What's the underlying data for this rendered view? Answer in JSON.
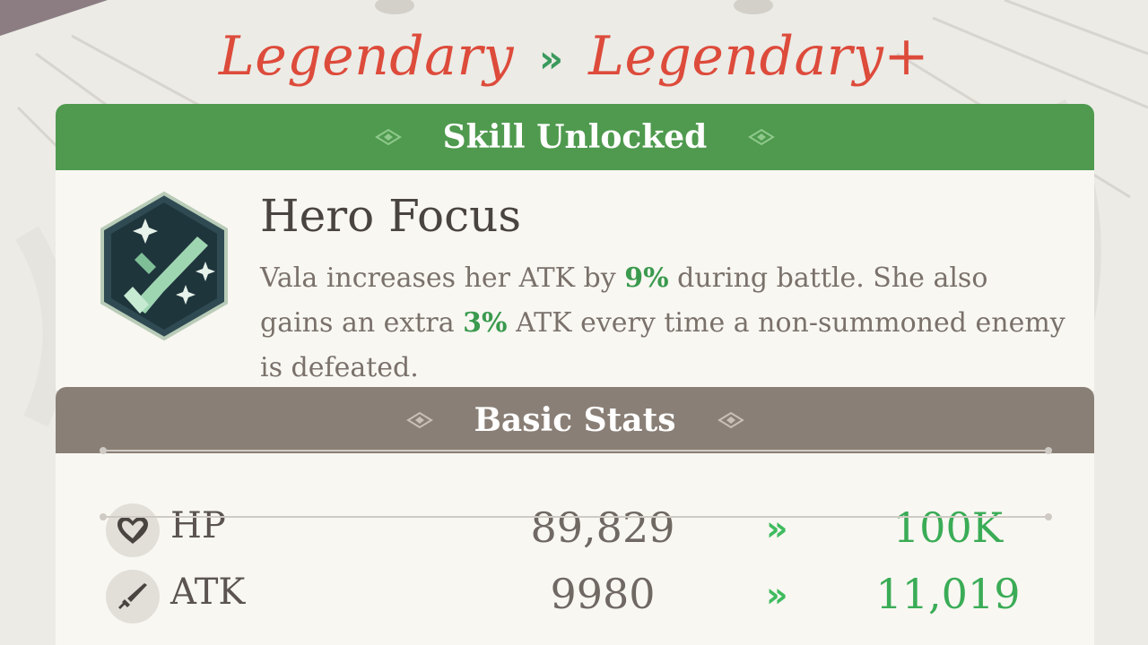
{
  "promotion": {
    "from_rank": "Legendary",
    "arrow": "»",
    "to_rank": "Legendary+"
  },
  "skill_section": {
    "header": "Skill Unlocked",
    "skill": {
      "name": "Hero Focus",
      "icon": "sword-sparkle-icon",
      "desc_part1": "Vala increases her ATK by ",
      "value1": "9%",
      "desc_part2": " during battle. She also gains an extra ",
      "value2": "3%",
      "desc_part3": " ATK every time a non-summoned enemy is defeated."
    }
  },
  "stats_section": {
    "header": "Basic Stats",
    "stats": [
      {
        "icon": "heart-icon",
        "label": "HP",
        "old": "89,829",
        "arrow": "»",
        "new": "100K"
      },
      {
        "icon": "sword-icon",
        "label": "ATK",
        "old": "9980",
        "arrow": "»",
        "new": "11,019"
      }
    ]
  },
  "colors": {
    "rank_red": "#dd4b3b",
    "skill_band_green": "#4f9a4e",
    "stats_band_brown": "#8a7f76",
    "highlight_green": "#3a9a4e",
    "stat_new_green": "#3aac56"
  }
}
